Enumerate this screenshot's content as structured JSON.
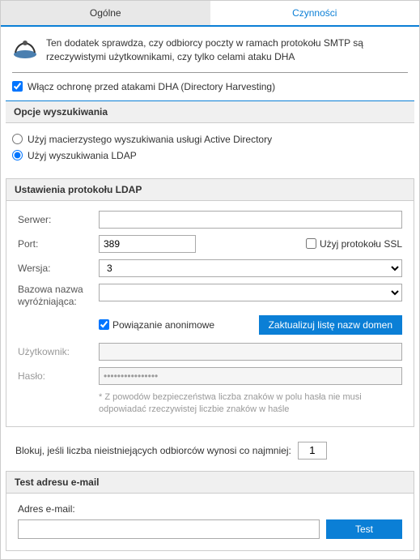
{
  "tabs": {
    "general": "Ogólne",
    "actions": "Czynności"
  },
  "description": "Ten dodatek sprawdza, czy odbiorcy poczty w ramach protokołu SMTP są rzeczywistymi użytkownikami, czy tylko celami ataku DHA",
  "enable_label": "Włącz ochronę przed atakami DHA (Directory Harvesting)",
  "search_options": {
    "header": "Opcje wyszukiwania",
    "radio_ad": "Użyj macierzystego wyszukiwania usługi Active Directory",
    "radio_ldap": "Użyj wyszukiwania LDAP"
  },
  "ldap": {
    "header": "Ustawienia protokołu LDAP",
    "server_label": "Serwer:",
    "server_value": "",
    "port_label": "Port:",
    "port_value": "389",
    "ssl_label": "Użyj protokołu SSL",
    "version_label": "Wersja:",
    "version_value": "3",
    "base_dn_label": "Bazowa nazwa wyróżniająca:",
    "base_dn_value": "",
    "anon_label": "Powiązanie anonimowe",
    "update_btn": "Zaktualizuj listę nazw domen",
    "user_label": "Użytkownik:",
    "user_value": "",
    "password_label": "Hasło:",
    "password_value": "••••••••••••••••",
    "note": "* Z powodów bezpieczeństwa liczba znaków w polu hasła nie musi odpowiadać rzeczywistej liczbie znaków w haśle"
  },
  "block": {
    "label": "Blokuj, jeśli liczba nieistniejących odbiorców wynosi co najmniej:",
    "value": "1"
  },
  "test": {
    "header": "Test adresu e-mail",
    "label": "Adres e-mail:",
    "value": "",
    "button": "Test"
  }
}
